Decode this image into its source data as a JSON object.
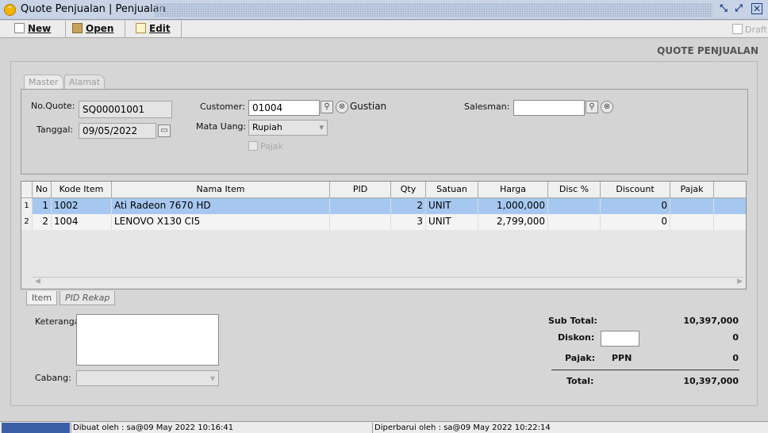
{
  "window": {
    "title": "Quote Penjualan | Penjualan"
  },
  "toolbar": {
    "new_label": "New",
    "open_label": "Open",
    "edit_label": "Edit",
    "draft_label": "Draft"
  },
  "page": {
    "heading": "QUOTE PENJUALAN"
  },
  "tabs": {
    "master": "Master",
    "alamat": "Alamat"
  },
  "form": {
    "no_quote_label": "No.Quote:",
    "no_quote_value": "SQ00001001",
    "tanggal_label": "Tanggal:",
    "tanggal_value": "09/05/2022",
    "customer_label": "Customer:",
    "customer_code": "01004",
    "customer_name": "Gustian",
    "mata_uang_label": "Mata Uang:",
    "mata_uang_value": "Rupiah",
    "pajak_label": "Pajak",
    "salesman_label": "Salesman:",
    "salesman_value": ""
  },
  "grid": {
    "columns": [
      "No",
      "Kode Item",
      "Nama Item",
      "PID",
      "Qty",
      "Satuan",
      "Harga",
      "Disc %",
      "Discount",
      "Pajak"
    ],
    "rows": [
      {
        "rownum": "1",
        "no": "1",
        "kode": "1002",
        "nama": "Ati Radeon 7670 HD",
        "pid": "",
        "qty": "2",
        "satuan": "UNIT",
        "harga": "1,000,000",
        "disc": "",
        "discount": "0",
        "pajak": ""
      },
      {
        "rownum": "2",
        "no": "2",
        "kode": "1004",
        "nama": "LENOVO X130 CI5",
        "pid": "",
        "qty": "3",
        "satuan": "UNIT",
        "harga": "2,799,000",
        "disc": "",
        "discount": "0",
        "pajak": ""
      }
    ]
  },
  "bottom_tabs": {
    "item": "Item",
    "pid_rekap": "PID Rekap"
  },
  "notes": {
    "keterangan_label": "Keterangan:",
    "cabang_label": "Cabang:"
  },
  "totals": {
    "sub_total_label": "Sub Total:",
    "sub_total_value": "10,397,000",
    "diskon_label": "Diskon:",
    "diskon_value": "0",
    "pajak_label": "Pajak:",
    "pajak_type": "PPN",
    "pajak_value": "0",
    "total_label": "Total:",
    "total_value": "10,397,000"
  },
  "status": {
    "created": "Dibuat oleh : sa@09 May 2022  10:16:41",
    "updated": "Diperbarui oleh : sa@09 May 2022  10:22:14"
  },
  "colors": {
    "selected_row": "#a6c8f0",
    "titlebar": "#c8d4e6",
    "status_blue": "#3a5ea8"
  }
}
